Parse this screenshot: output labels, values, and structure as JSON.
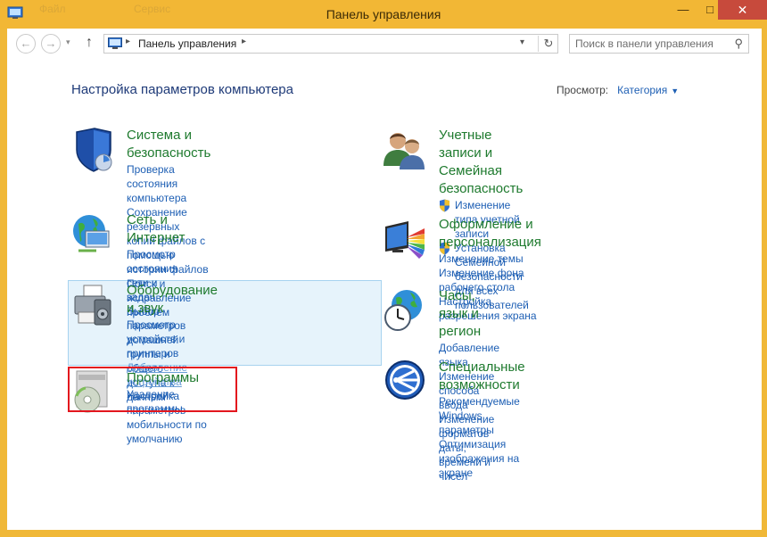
{
  "window": {
    "title": "Панель управления",
    "ghost_tabs": [
      "Файл",
      "Сервис"
    ],
    "min_label": "—",
    "max_label": "□",
    "close_label": "✕"
  },
  "nav": {
    "back_glyph": "←",
    "forward_glyph": "→",
    "dropdown_glyph": "▾",
    "up_glyph": "↑",
    "breadcrumb": [
      "Панель управления"
    ],
    "breadcrumb_sep": "▸",
    "address_dropdown_glyph": "▾",
    "refresh_glyph": "↻",
    "search_placeholder": "Поиск в панели управления",
    "search_glyph": "⚲"
  },
  "page": {
    "heading": "Настройка параметров компьютера",
    "view_label": "Просмотр:",
    "view_value": "Категория",
    "view_caret": "▼"
  },
  "categories": [
    {
      "title": "Система и безопасность",
      "icon": "shield-icon",
      "links": [
        "Проверка состояния компьютера",
        "Сохранение резервных копий файлов с помощью",
        "истории файлов",
        "Поиск и исправление проблем"
      ]
    },
    {
      "title": "Сеть и Интернет",
      "icon": "network-globe-icon",
      "links": [
        "Просмотр состояния сети и задач",
        "Выбор параметров домашней группы и общего",
        "доступа к данным"
      ]
    },
    {
      "title": "Оборудование и звук",
      "icon": "printer-icon",
      "links": [
        "Просмотр устройств и принтеров",
        "Добавление устройства",
        "Настройка параметров мобильности по",
        "умолчанию"
      ]
    },
    {
      "title": "Программы",
      "icon": "programs-disc-icon",
      "links": [
        "Удаление программы"
      ]
    },
    {
      "title_lines": [
        "Учетные записи и Семейная",
        "безопасность"
      ],
      "icon": "users-icon",
      "links": [
        "Изменение типа учетной записи",
        "Установка Семейной безопасности для всех",
        "пользователей"
      ]
    },
    {
      "title": "Оформление и персонализация",
      "icon": "display-palette-icon",
      "links": [
        "Изменение темы",
        "Изменение фона рабочего стола",
        "Настройка разрешения экрана"
      ]
    },
    {
      "title": "Часы, язык и регион",
      "icon": "clock-globe-icon",
      "links": [
        "Добавление языка",
        "Изменение способа ввода",
        "Изменение форматов даты, времени и чисел"
      ]
    },
    {
      "title": "Специальные возможности",
      "icon": "accessibility-icon",
      "links": [
        "Рекомендуемые Windows параметры",
        "Оптимизация изображения на экране"
      ]
    }
  ],
  "colors": {
    "frame": "#f2b735",
    "category_title": "#1e7a2e",
    "link": "#1e5fb4",
    "heading": "#1e3a78",
    "highlight_border": "#e3161e",
    "hover_bg": "#e6f3fb"
  }
}
